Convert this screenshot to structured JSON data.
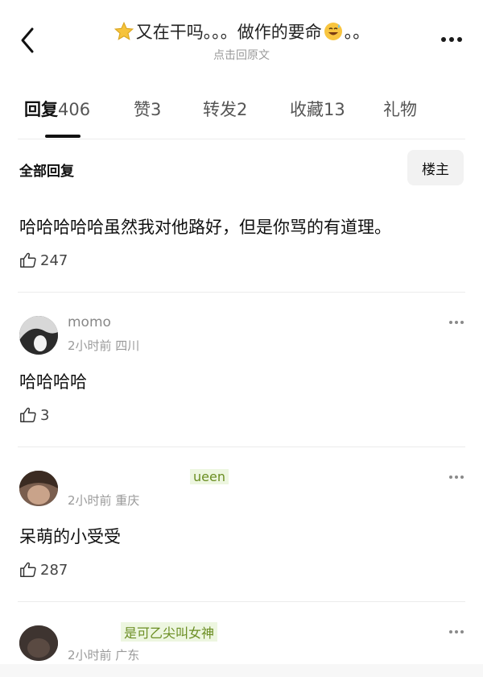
{
  "header": {
    "title_text": "又在干吗。。。做作的要命",
    "title_tail": "。。",
    "subtitle": "点击回原文",
    "star_icon": "star-icon",
    "emoji_icon": "sweat-smile-emoji"
  },
  "tabs": [
    {
      "label": "回复",
      "count": "406"
    },
    {
      "label": "赞",
      "count": "3"
    },
    {
      "label": "转发",
      "count": "2"
    },
    {
      "label": "收藏",
      "count": "13"
    },
    {
      "label": "礼物",
      "count": ""
    }
  ],
  "section": {
    "label": "全部回复",
    "filter_button": "楼主"
  },
  "comments": [
    {
      "name": "",
      "meta": "",
      "text": "哈哈哈哈哈虽然我对他路好，但是你骂的有道理。",
      "likes": "247"
    },
    {
      "name": "momo",
      "meta": "2小时前 四川",
      "text": "哈哈哈哈",
      "likes": "3"
    },
    {
      "name": "ueen",
      "meta": "2小时前 重庆",
      "text": "呆萌的小受受",
      "likes": "287"
    },
    {
      "name": "",
      "badge": "是可乙尖叫女神",
      "meta": "2小时前 广东",
      "text": "",
      "likes": ""
    }
  ],
  "colors": {
    "accent": "#111111",
    "muted": "#9a9a9a",
    "badge": "#6b8e23"
  }
}
